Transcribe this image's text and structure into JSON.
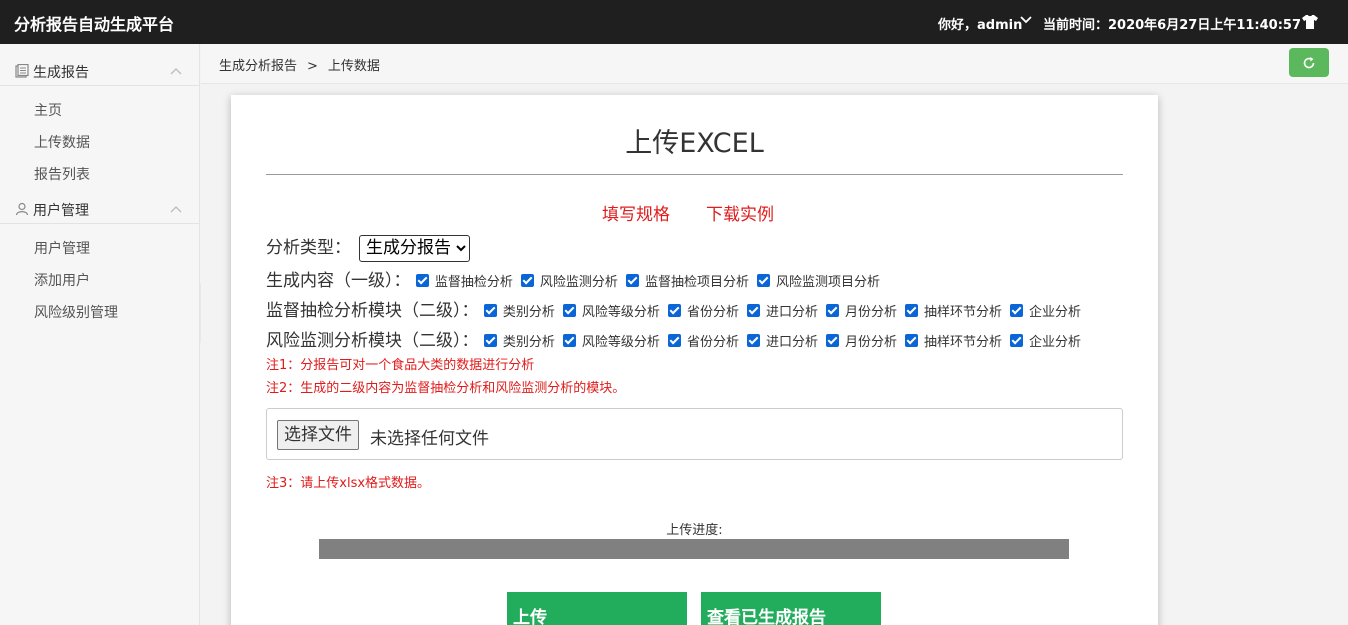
{
  "topbar": {
    "brand": "分析报告自动生成平台",
    "greeting": "你好，admin",
    "time_label": "当前时间：2020年6月27日上午11:40:57"
  },
  "sidebar": {
    "groups": [
      {
        "label": "生成报告",
        "icon": "report-icon",
        "items": [
          "主页",
          "上传数据",
          "报告列表"
        ]
      },
      {
        "label": "用户管理",
        "icon": "user-icon",
        "items": [
          "用户管理",
          "添加用户",
          "风险级别管理"
        ]
      }
    ]
  },
  "breadcrumb": {
    "parent": "生成分析报告",
    "separator": ">",
    "current": "上传数据"
  },
  "card": {
    "title": "上传EXCEL",
    "link_spec": "填写规格",
    "link_example": "下载实例",
    "analysis_type_label": "分析类型：",
    "analysis_type_value": "生成分报告",
    "level1_label": "生成内容（一级）：",
    "level1_options": [
      "监督抽检分析",
      "风险监测分析",
      "监督抽检项目分析",
      "风险监测项目分析"
    ],
    "supervision_label": "监督抽检分析模块（二级）：",
    "supervision_options": [
      "类别分析",
      "风险等级分析",
      "省份分析",
      "进口分析",
      "月份分析",
      "抽样环节分析",
      "企业分析"
    ],
    "risk_label": "风险监测分析模块（二级）：",
    "risk_options": [
      "类别分析",
      "风险等级分析",
      "省份分析",
      "进口分析",
      "月份分析",
      "抽样环节分析",
      "企业分析"
    ],
    "note1": "注1：分报告可对一个食品大类的数据进行分析",
    "note2": "注2：生成的二级内容为监督抽检分析和风险监测分析的模块。",
    "file_button": "选择文件",
    "file_status": "未选择任何文件",
    "note3": "注3：请上传xlsx格式数据。",
    "progress_label": "上传进度:",
    "progress_percent": 0,
    "upload_button": "上传",
    "view_button": "查看已生成报告"
  },
  "colors": {
    "topbar": "#1f1f1f",
    "accent_green": "#22ad5c",
    "note_red": "#e01b1b",
    "checkbox_blue": "#0a66d6"
  }
}
